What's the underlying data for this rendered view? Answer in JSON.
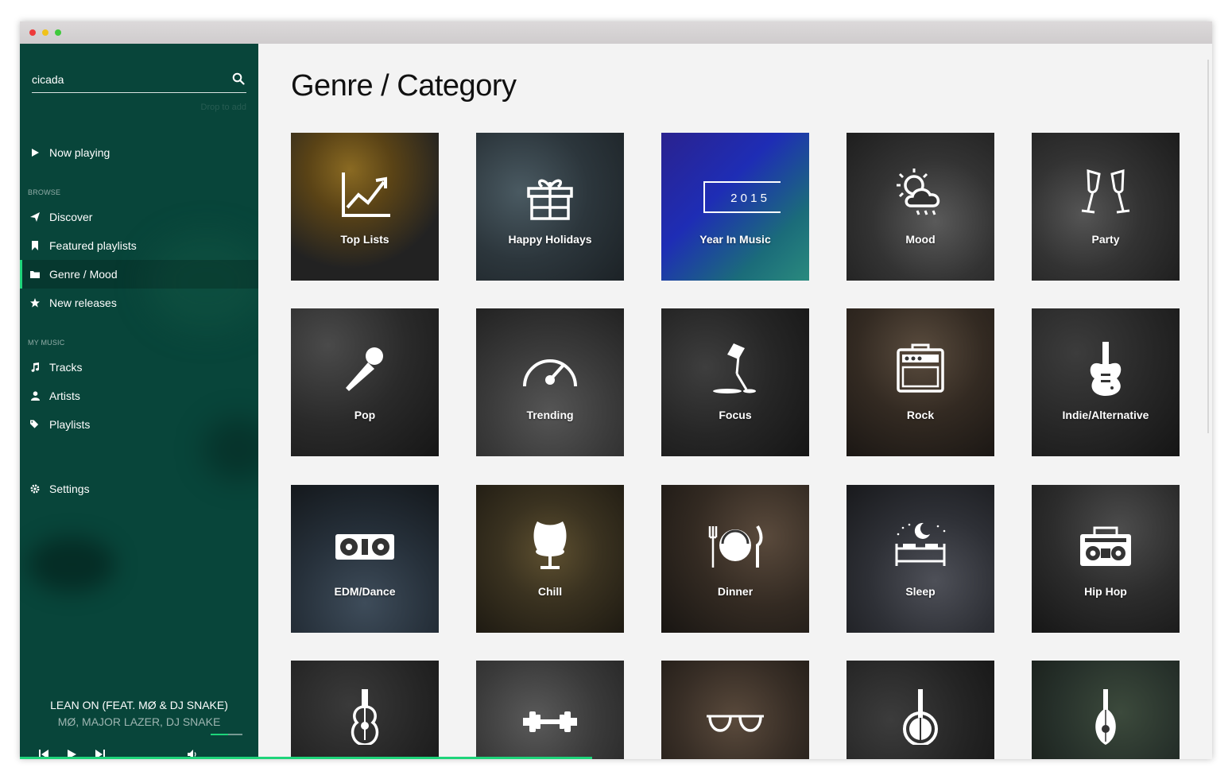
{
  "search": {
    "value": "cicada",
    "hint": "Drop to add"
  },
  "nav": {
    "now_playing": "Now playing",
    "browse_header": "BROWSE",
    "discover": "Discover",
    "featured": "Featured playlists",
    "genre": "Genre / Mood",
    "new_releases": "New releases",
    "my_music_header": "MY MUSIC",
    "tracks": "Tracks",
    "artists": "Artists",
    "playlists": "Playlists",
    "settings": "Settings"
  },
  "player": {
    "title": "LEAN ON (FEAT. MØ & DJ SNAKE)",
    "artist": "MØ, MAJOR LAZER, DJ SNAKE",
    "volume": 0.55,
    "progress": 0.48
  },
  "main": {
    "title": "Genre / Category",
    "year_badge": "2 0 1 5",
    "tiles": [
      {
        "label": "Top Lists",
        "icon": "chart-icon"
      },
      {
        "label": "Happy Holidays",
        "icon": "gift-icon"
      },
      {
        "label": "Year In Music",
        "icon": "year-badge-icon"
      },
      {
        "label": "Mood",
        "icon": "weather-icon"
      },
      {
        "label": "Party",
        "icon": "champagne-icon"
      },
      {
        "label": "Pop",
        "icon": "microphone-icon"
      },
      {
        "label": "Trending",
        "icon": "gauge-icon"
      },
      {
        "label": "Focus",
        "icon": "desk-lamp-icon"
      },
      {
        "label": "Rock",
        "icon": "amplifier-icon"
      },
      {
        "label": "Indie/Alternative",
        "icon": "electric-guitar-icon"
      },
      {
        "label": "EDM/Dance",
        "icon": "turntables-icon"
      },
      {
        "label": "Chill",
        "icon": "egg-chair-icon"
      },
      {
        "label": "Dinner",
        "icon": "plate-cutlery-icon"
      },
      {
        "label": "Sleep",
        "icon": "bed-moon-icon"
      },
      {
        "label": "Hip Hop",
        "icon": "boombox-icon"
      },
      {
        "label": "",
        "icon": "acoustic-guitar-icon"
      },
      {
        "label": "",
        "icon": "dumbbell-icon"
      },
      {
        "label": "",
        "icon": "sunglasses-icon"
      },
      {
        "label": "",
        "icon": "banjo-icon"
      },
      {
        "label": "",
        "icon": "mandolin-icon"
      }
    ]
  },
  "colors": {
    "sidebar": "#08453a",
    "accent": "#1ed47a",
    "content_bg": "#f3f3f3"
  }
}
